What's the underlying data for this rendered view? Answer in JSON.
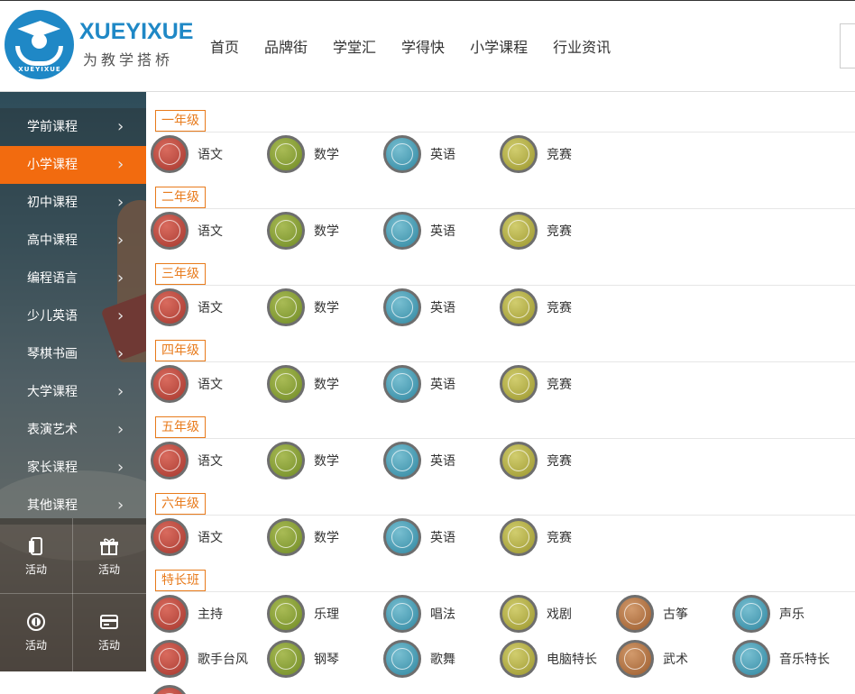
{
  "header": {
    "logo_title": "XUEYIXUE",
    "logo_sub": "为教学搭桥",
    "logo_ring_text": "XUEYIXUE",
    "nav": [
      "首页",
      "品牌街",
      "学堂汇",
      "学得快",
      "小学课程",
      "行业资讯"
    ]
  },
  "sidebar": {
    "items": [
      {
        "label": "学前课程",
        "active": false
      },
      {
        "label": "小学课程",
        "active": true
      },
      {
        "label": "初中课程",
        "active": false
      },
      {
        "label": "高中课程",
        "active": false
      },
      {
        "label": "编程语言",
        "active": false
      },
      {
        "label": "少儿英语",
        "active": false
      },
      {
        "label": "琴棋书画",
        "active": false
      },
      {
        "label": "大学课程",
        "active": false
      },
      {
        "label": "表演艺术",
        "active": false
      },
      {
        "label": "家长课程",
        "active": false
      },
      {
        "label": "其他课程",
        "active": false
      }
    ],
    "chevron": "›",
    "grid": [
      {
        "label": "活动",
        "icon": "phone-icon"
      },
      {
        "label": "活动",
        "icon": "gift-icon"
      },
      {
        "label": "活动",
        "icon": "badge-icon"
      },
      {
        "label": "活动",
        "icon": "card-icon"
      }
    ]
  },
  "grades": [
    {
      "tag": "一年级",
      "subjects": [
        "语文",
        "数学",
        "英语",
        "竞赛"
      ]
    },
    {
      "tag": "二年级",
      "subjects": [
        "语文",
        "数学",
        "英语",
        "竞赛"
      ]
    },
    {
      "tag": "三年级",
      "subjects": [
        "语文",
        "数学",
        "英语",
        "竞赛"
      ]
    },
    {
      "tag": "四年级",
      "subjects": [
        "语文",
        "数学",
        "英语",
        "竞赛"
      ]
    },
    {
      "tag": "五年级",
      "subjects": [
        "语文",
        "数学",
        "英语",
        "竞赛"
      ]
    },
    {
      "tag": "六年级",
      "subjects": [
        "语文",
        "数学",
        "英语",
        "竞赛"
      ]
    }
  ],
  "special": {
    "tag": "特长班",
    "row1": [
      "主持",
      "乐理",
      "唱法",
      "戏剧",
      "古筝",
      "声乐"
    ],
    "row2": [
      "歌手台风",
      "钢琴",
      "歌舞",
      "电脑特长",
      "武术",
      "音乐特长"
    ]
  },
  "colors": {
    "accent_orange": "#f26b0f",
    "tag_orange": "#e87b1c",
    "brand_blue": "#1f88c6"
  }
}
